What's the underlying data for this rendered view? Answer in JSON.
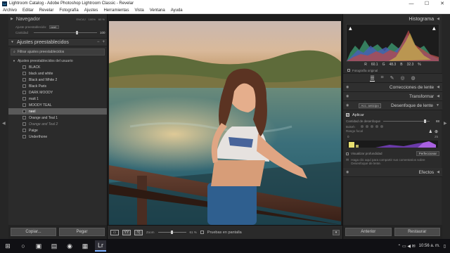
{
  "window": {
    "icon_text": "Lr",
    "title": "Lightroom Catalog - Adobe Photoshop Lightroom Classic - Revelar",
    "minimize": "—",
    "maximize": "☐",
    "close": "✕"
  },
  "menu": [
    "Archivo",
    "Editar",
    "Revelar",
    "Fotografía",
    "Ajustes",
    "Herramientas",
    "Vista",
    "Ventana",
    "Ayuda"
  ],
  "navigator": {
    "title": "Navegador",
    "opts": [
      "ENCAJ",
      "100%",
      "60 %"
    ],
    "preset_label": "Ajuste preestablecido:",
    "preset_value": "neel",
    "amount_label": "Cantidad",
    "amount_value": "100"
  },
  "presets": {
    "title": "Ajustes preestablecidos",
    "filter_placeholder": "Filtrar ajustes preestablecidos",
    "group_label": "Ajustes preestablecidos del usuario",
    "items": [
      {
        "name": "BLACK",
        "state": "normal"
      },
      {
        "name": "black and white",
        "state": "normal"
      },
      {
        "name": "Black and White 2",
        "state": "normal"
      },
      {
        "name": "Black Paris",
        "state": "normal"
      },
      {
        "name": "DARK MOODY",
        "state": "normal"
      },
      {
        "name": "matt 1",
        "state": "normal"
      },
      {
        "name": "MOODY TEAL",
        "state": "normal"
      },
      {
        "name": "neel",
        "state": "selected"
      },
      {
        "name": "Orange and Teal 1",
        "state": "normal"
      },
      {
        "name": "Orange and Teal 2",
        "state": "dim"
      },
      {
        "name": "Paige",
        "state": "normal"
      },
      {
        "name": "Underthone",
        "state": "normal"
      }
    ],
    "copy_button": "Copiar...",
    "paste_button": "Pegar"
  },
  "toolbar": {
    "zoom_label": "Zoom",
    "zoom_value": "61 %",
    "proof_label": "Pruebas en pantalla"
  },
  "right": {
    "histogram_title": "Histograma",
    "readout": [
      "R",
      "60.1",
      "G",
      "48.3",
      "B",
      "32.3",
      "%"
    ],
    "original_photo": "Fotografía original",
    "sections": {
      "lens": "Correcciones de lente",
      "transform": "Transformar",
      "lens_blur": "Desenfoque de lente",
      "lens_blur_badge": "Acc. anticipo",
      "effects": "Efectos"
    },
    "blur": {
      "apply": "Aplicar",
      "amount_label": "Cantidad de desenfoque",
      "amount_value": "88",
      "bokeh_label": "Bokeh",
      "focal_label": "Rango focal",
      "focal_min": "0",
      "focal_max": "25",
      "depth_label": "Visualizar profundidad",
      "refine_label": "Perfeccionar",
      "feedback": "Haga clic aquí para compartir sus comentarios sobre Desenfoque de lente."
    },
    "prev_button": "Anterior",
    "reset_button": "Restaurar"
  },
  "taskbar": {
    "time": "10:56 a. m.",
    "tray_icons": "⌃ ▭ ◀ ✉"
  },
  "colors": {
    "panel_bg": "#2b2b2b",
    "selected_row": "#5a5a5a",
    "taskbar_accent": "#7ab0ff"
  }
}
